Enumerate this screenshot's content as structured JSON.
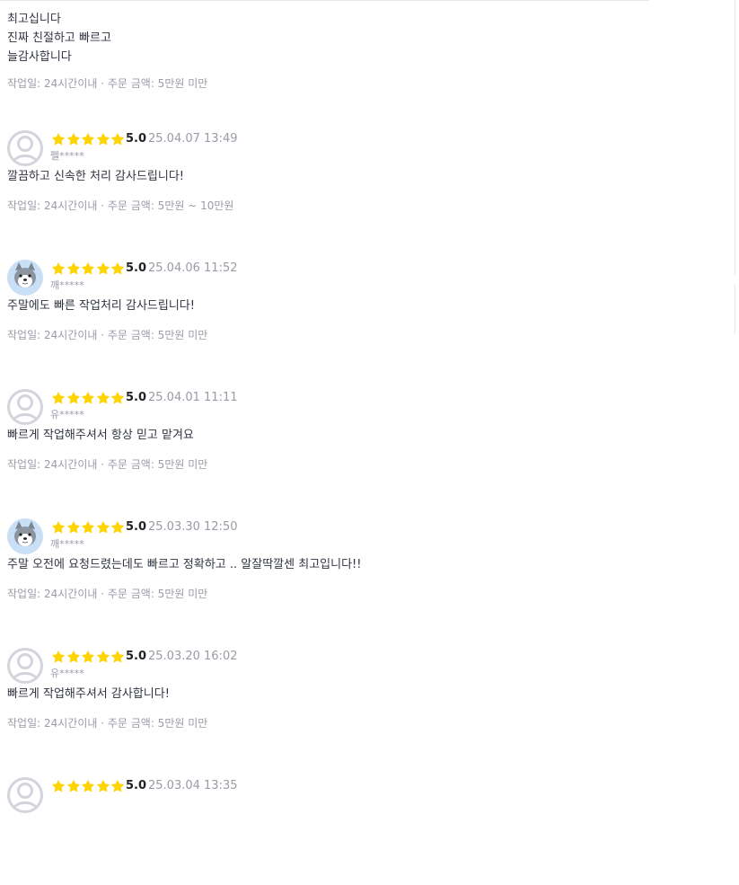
{
  "first_review": {
    "lines": [
      "최고십니다",
      "진짜 친절하고 빠르고",
      "늘감사합니다"
    ],
    "meta": "작업일: 24시간이내 · 주문 금액: 5만원 미만"
  },
  "colors": {
    "star": "#ffd400",
    "meta_text": "#9a9ba7",
    "body_text": "#303441",
    "avatar_ring": "#d3d4dc"
  },
  "reviews": [
    {
      "avatar": "default-avatar",
      "stars": 5,
      "rating": "5.0",
      "date": "25.04.07 13:49",
      "nickname": "펠*****",
      "text": "깔끔하고 신속한 처리 감사드립니다!",
      "meta": "작업일: 24시간이내 · 주문 금액: 5만원 ~ 10만원"
    },
    {
      "avatar": "wolf-avatar",
      "stars": 5,
      "rating": "5.0",
      "date": "25.04.06 11:52",
      "nickname": "깨*****",
      "text": "주말에도 빠른 작업처리 감사드립니다!",
      "meta": "작업일: 24시간이내 · 주문 금액: 5만원 미만"
    },
    {
      "avatar": "default-avatar",
      "stars": 5,
      "rating": "5.0",
      "date": "25.04.01 11:11",
      "nickname": "유*****",
      "text": "빠르게 작업해주셔서 항상 믿고 맡겨요",
      "meta": "작업일: 24시간이내 · 주문 금액: 5만원 미만"
    },
    {
      "avatar": "wolf-avatar",
      "stars": 5,
      "rating": "5.0",
      "date": "25.03.30 12:50",
      "nickname": "깨*****",
      "text": "주말 오전에 요청드렸는데도 빠르고 정확하고 .. 알잘딱깔센 최고입니다!!",
      "meta": "작업일: 24시간이내 · 주문 금액: 5만원 미만"
    },
    {
      "avatar": "default-avatar",
      "stars": 5,
      "rating": "5.0",
      "date": "25.03.20 16:02",
      "nickname": "유*****",
      "text": "빠르게 작업해주셔서 감사합니다!",
      "meta": "작업일: 24시간이내 · 주문 금액: 5만원 미만"
    },
    {
      "avatar": "default-avatar",
      "stars": 5,
      "rating": "5.0",
      "date": "25.03.04 13:35",
      "nickname": "",
      "text": "",
      "meta": ""
    }
  ]
}
